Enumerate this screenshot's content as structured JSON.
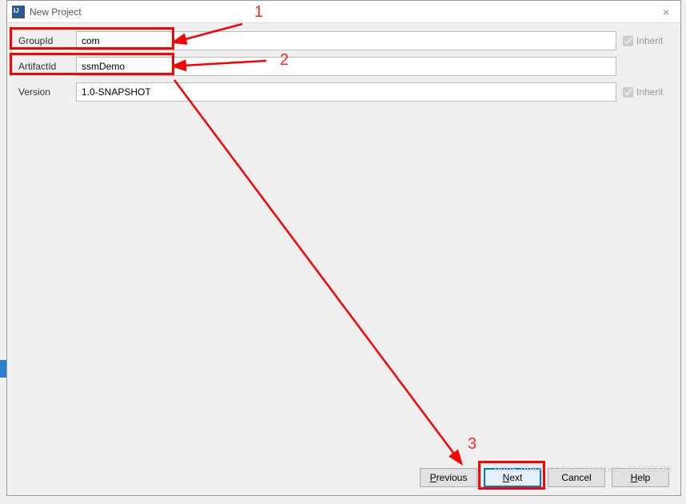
{
  "window": {
    "title": "New Project"
  },
  "fields": {
    "groupId": {
      "label": "GroupId",
      "value": "com",
      "inherit": "Inherit"
    },
    "artifactId": {
      "label": "ArtifactId",
      "value": "ssmDemo"
    },
    "version": {
      "label": "Version",
      "value": "1.0-SNAPSHOT",
      "inherit": "Inherit"
    }
  },
  "buttons": {
    "previous": "Previous",
    "next": "Next",
    "cancel": "Cancel",
    "help": "Help"
  },
  "annotations": {
    "label1": "1",
    "label2": "2",
    "label3": "3"
  },
  "watermark": "https://blog.csdn.net/weixin_41583536"
}
